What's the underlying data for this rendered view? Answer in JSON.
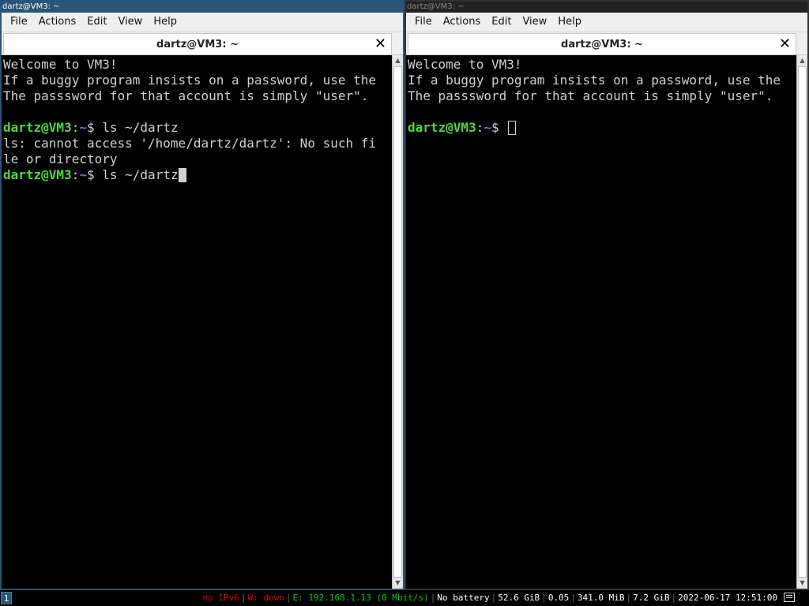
{
  "windows": {
    "left": {
      "titlebar": "dartz@VM3: ~",
      "menu": [
        "File",
        "Actions",
        "Edit",
        "View",
        "Help"
      ],
      "tab_title": "dartz@VM3: ~",
      "lines": [
        "Welcome to VM3!",
        "If a buggy program insists on a password, use the",
        "The passsword for that account is simply \"user\".",
        "",
        "ls: cannot access '/home/dartz/dartz': No such fi",
        "le or directory"
      ],
      "prompt_user": "dartz@VM3",
      "prompt_colon": ":",
      "prompt_path": "~",
      "prompt_dollar": "$",
      "cmd1": " ls ~/dartz",
      "cmd2": " ls ~/dartz"
    },
    "right": {
      "titlebar": "dartz@VM3: ~",
      "menu": [
        "File",
        "Actions",
        "Edit",
        "View",
        "Help"
      ],
      "tab_title": "dartz@VM3: ~",
      "lines": [
        "Welcome to VM3!",
        "If a buggy program insists on a password, use the",
        "The passsword for that account is simply \"user\".",
        ""
      ],
      "prompt_user": "dartz@VM3",
      "prompt_colon": ":",
      "prompt_path": "~",
      "prompt_dollar": "$",
      "cmd1": " "
    }
  },
  "statusbar": {
    "workspace": "1",
    "ipv6": "no IPv6",
    "wireless": "W: down",
    "ethernet": "E: 192.168.1.13 (0 Mbit/s)",
    "battery": "No battery",
    "disk": "52.6 GiB",
    "load": "0.05",
    "memory": "341.0 MiB",
    "disk2": "7.2 GiB",
    "datetime": "2022-06-17 12:51:00",
    "separator": "|",
    "colors": {
      "red": "#e00000",
      "green": "#00d000",
      "focus": "#285577"
    }
  },
  "icons": {
    "close": "close-icon",
    "tray": "tray-window-icon",
    "scroll_up": "arrow-up-icon",
    "scroll_down": "arrow-down-icon"
  }
}
